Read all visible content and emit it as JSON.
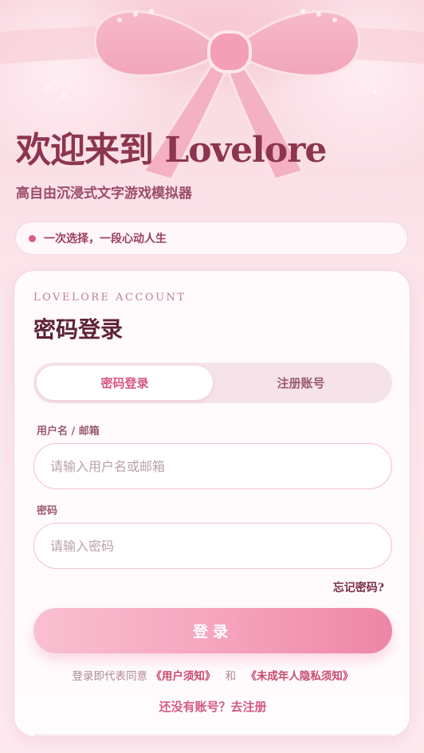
{
  "hero": {
    "title": "欢迎来到 Lovelore",
    "subtitle": "高自由沉浸式文字游戏模拟器",
    "slogan": "一次选择，一段心动人生"
  },
  "card": {
    "eyebrow": "LOVELORE ACCOUNT",
    "title": "密码登录",
    "tabs": [
      {
        "label": "密码登录",
        "active": true
      },
      {
        "label": "注册账号",
        "active": false
      }
    ],
    "username": {
      "label": "用户名 / 邮箱",
      "placeholder": "请输入用户名或邮箱",
      "value": ""
    },
    "password": {
      "label": "密码",
      "placeholder": "请输入密码",
      "value": ""
    },
    "forgot_label": "忘记密码?",
    "login_label": "登录",
    "agreement": {
      "prefix": "登录即代表同意",
      "terms": "《用户须知》",
      "and": "和",
      "privacy": "《未成年人隐私须知》"
    },
    "register_prompt": "还没有账号？去注册"
  },
  "colors": {
    "accent": "#d9577f",
    "title": "#8c3550",
    "background": "#fbe3ea"
  }
}
